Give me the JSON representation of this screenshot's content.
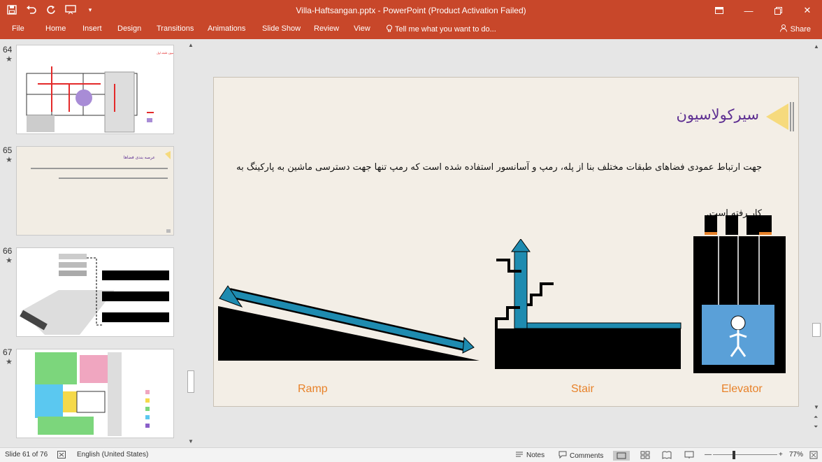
{
  "app": {
    "title": "Villa-Haftsangan.pptx - PowerPoint (Product Activation Failed)",
    "qat": {
      "save_icon": "save-icon",
      "undo_icon": "undo-icon",
      "redo_icon": "redo-icon",
      "present_icon": "present-icon",
      "customize_icon": "chevron-down-icon"
    }
  },
  "ribbon": {
    "tabs": [
      "File",
      "Home",
      "Insert",
      "Design",
      "Transitions",
      "Animations",
      "Slide Show",
      "Review",
      "View"
    ],
    "tell_me": "Tell me what you want to do...",
    "share": "Share"
  },
  "thumbnails": [
    {
      "number": "64",
      "star": "★"
    },
    {
      "number": "65",
      "star": "★",
      "title": "عرصه بندی فضاها"
    },
    {
      "number": "66",
      "star": "★"
    },
    {
      "number": "67",
      "star": "★"
    }
  ],
  "slide": {
    "title": "سیرکولاسیون",
    "body": "جهت ارتباط عمودی فضاهای طبقات مختلف بنا از پله، رمپ و آسانسور استفاده شده است که رمپ تنها جهت دسترسی ماشین به پارکینگ به کار رفته است.",
    "labels": {
      "ramp": "Ramp",
      "stair": "Stair",
      "elevator": "Elevator"
    },
    "colors": {
      "title": "#5c2d91",
      "label": "#e8822a",
      "arrow": "#1e8bb0",
      "elevator_cabin": "#5aa0d8",
      "accent": "#f6da7d"
    }
  },
  "status": {
    "slide_info": "Slide 61 of 76",
    "language": "English (United States)",
    "notes": "Notes",
    "comments": "Comments",
    "zoom": "77%"
  }
}
